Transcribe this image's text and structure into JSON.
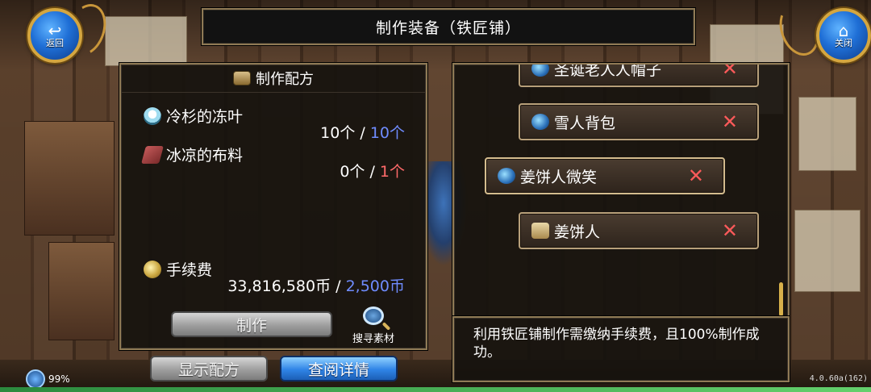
{
  "nav": {
    "back_label": "返回",
    "close_label": "关闭"
  },
  "title": "制作装备（铁匠铺）",
  "recipe_panel": {
    "header": "制作配方",
    "materials": [
      {
        "name": "冷杉的冻叶",
        "have": "10个",
        "sep": " / ",
        "need": "10个",
        "need_color": "#6f8cff",
        "icon": "frozen-leaf-icon"
      },
      {
        "name": "冰凉的布料",
        "have": "0个",
        "sep": " / ",
        "need": "1个",
        "need_color": "#ff6a6a",
        "icon": "cloth-icon"
      }
    ],
    "fee_label": "手续费",
    "fee_have": "33,816,580币",
    "fee_sep": " / ",
    "fee_need": "2,500币",
    "make_button": "制作",
    "search_label": "搜寻素材"
  },
  "bottom_buttons": {
    "show_recipe": "显示配方",
    "view_details": "查阅详情"
  },
  "recipe_list": [
    {
      "name": "圣诞老人人帽子",
      "icon": "hat-icon",
      "mark": "✕"
    },
    {
      "name": "雪人背包",
      "icon": "backpack-icon",
      "mark": "✕"
    },
    {
      "name": "姜饼人微笑",
      "icon": "smile-icon",
      "mark": "✕"
    },
    {
      "name": "姜饼人",
      "icon": "scroll-icon",
      "mark": "✕"
    }
  ],
  "description": "利用铁匠铺制作需缴纳手续费，且100%制作成功。",
  "status": {
    "battery": "99%",
    "version": "4.0.60a(162)"
  },
  "colors": {
    "blue_accent": "#6f8cff",
    "red_accent": "#ff6a6a",
    "gold_border": "#8f7a55"
  }
}
